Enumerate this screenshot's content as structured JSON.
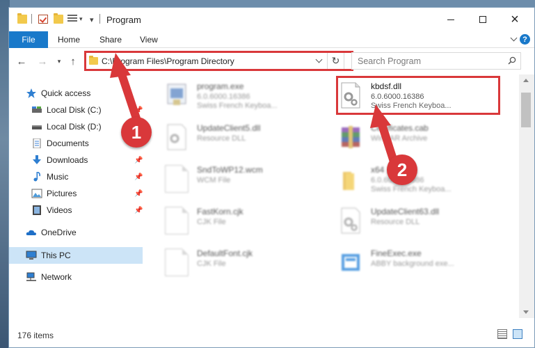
{
  "window": {
    "title": "Program"
  },
  "ribbon": {
    "tabs": [
      "File",
      "Home",
      "Share",
      "View"
    ]
  },
  "address": {
    "path": "C:\\Program Files\\Program Directory"
  },
  "search": {
    "placeholder": "Search Program"
  },
  "sidebar": {
    "items": [
      {
        "label": "Quick access",
        "icon": "star-icon",
        "pinned": false
      },
      {
        "label": "Local Disk (C:)",
        "icon": "drive-icon",
        "pinned": true
      },
      {
        "label": "Local Disk (D:)",
        "icon": "drive-icon",
        "pinned": true
      },
      {
        "label": "Documents",
        "icon": "documents-icon",
        "pinned": true
      },
      {
        "label": "Downloads",
        "icon": "download-icon",
        "pinned": true
      },
      {
        "label": "Music",
        "icon": "music-icon",
        "pinned": true
      },
      {
        "label": "Pictures",
        "icon": "pictures-icon",
        "pinned": true
      },
      {
        "label": "Videos",
        "icon": "videos-icon",
        "pinned": true
      },
      {
        "label": "OneDrive",
        "icon": "cloud-icon",
        "pinned": false
      },
      {
        "label": "This PC",
        "icon": "computer-icon",
        "pinned": false,
        "selected": true
      },
      {
        "label": "Network",
        "icon": "network-icon",
        "pinned": false
      }
    ]
  },
  "files": [
    {
      "name": "program.exe",
      "line2": "6.0.6000.16386",
      "line3": "Swiss French Keyboa...",
      "icon": "exe-icon",
      "blurred": true
    },
    {
      "name": "kbdsf.dll",
      "line2": "6.0.6000.16386",
      "line3": "Swiss French Keyboa...",
      "icon": "dll-gear-icon",
      "blurred": false
    },
    {
      "name": "UpdateClient5.dll",
      "line2": "Resource DLL",
      "line3": "",
      "icon": "dll-gear-icon",
      "blurred": true
    },
    {
      "name": "Certificates.cab",
      "line2": "WinRAR Archive",
      "line3": "",
      "icon": "archive-icon",
      "blurred": true
    },
    {
      "name": "SndToWP12.wcm",
      "line2": "WCM File",
      "line3": "",
      "icon": "file-icon",
      "blurred": true
    },
    {
      "name": "x64",
      "line2": "6.0.6000.16386",
      "line3": "Swiss French Keyboa...",
      "icon": "folder-icon",
      "blurred": true
    },
    {
      "name": "FastKorn.cjk",
      "line2": "CJK File",
      "line3": "",
      "icon": "file-icon",
      "blurred": true
    },
    {
      "name": "UpdateClient63.dll",
      "line2": "Resource DLL",
      "line3": "",
      "icon": "dll-gear-icon",
      "blurred": true
    },
    {
      "name": "DefaultFont.cjk",
      "line2": "CJK File",
      "line3": "",
      "icon": "file-icon",
      "blurred": true
    },
    {
      "name": "FineExec.exe",
      "line2": "ABBY background exe...",
      "line3": "",
      "icon": "exe-icon",
      "blurred": true
    }
  ],
  "status": {
    "item_count": "176 items"
  },
  "annotations": {
    "marker1": "1",
    "marker2": "2",
    "color": "#d9383a"
  },
  "colors": {
    "accent": "#1979ca",
    "selection": "#cce4f7"
  }
}
